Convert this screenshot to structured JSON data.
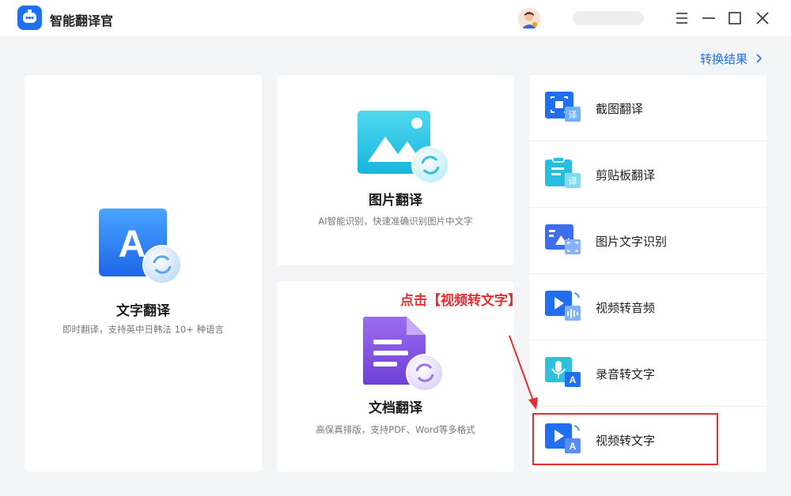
{
  "app": {
    "title": "智能翻译官",
    "logo_icon": "chat-bot-icon",
    "brand_color": "#1f6ff0"
  },
  "window_controls": [
    "menu-icon",
    "minimize-icon",
    "maximize-icon",
    "close-icon"
  ],
  "header": {
    "result_link": "转换结果"
  },
  "cards": {
    "text_translate": {
      "title": "文字翻译",
      "desc": "即时翻译，支持英中日韩法 10+ 种语言",
      "icon": "letter-a-translate-icon"
    },
    "image_translate": {
      "title": "图片翻译",
      "desc": "AI智能识别，快速准确识别图片中文字",
      "icon": "image-translate-icon"
    },
    "doc_translate": {
      "title": "文档翻译",
      "desc": "高保真排版，支持PDF、Word等多格式",
      "icon": "document-translate-icon"
    }
  },
  "side_items": [
    {
      "label": "截图翻译",
      "icon": "screenshot-translate-icon"
    },
    {
      "label": "剪贴板翻译",
      "icon": "clipboard-translate-icon"
    },
    {
      "label": "图片文字识别",
      "icon": "image-ocr-icon"
    },
    {
      "label": "视频转音频",
      "icon": "video-to-audio-icon"
    },
    {
      "label": "录音转文字",
      "icon": "recording-to-text-icon"
    },
    {
      "label": "视频转文字",
      "icon": "video-to-text-icon"
    }
  ],
  "annotation": {
    "text": "点击【视频转文字】",
    "color": "#e62e2e"
  }
}
